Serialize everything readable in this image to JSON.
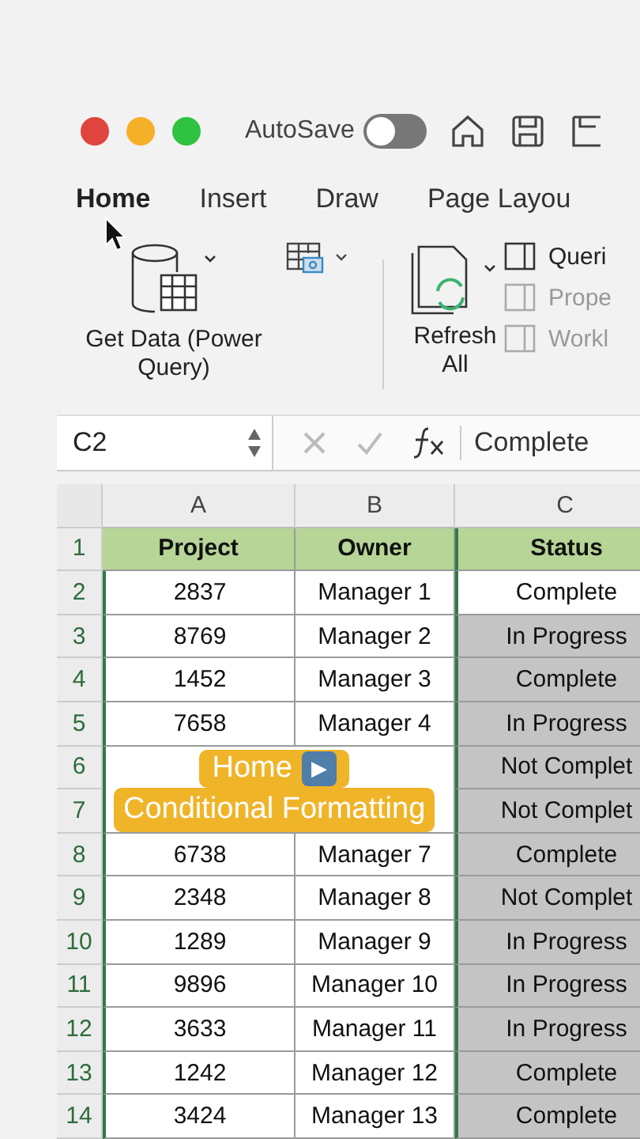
{
  "autosave": {
    "label": "AutoSave",
    "on": false
  },
  "tabs": [
    {
      "label": "Home",
      "selected": true
    },
    {
      "label": "Insert",
      "selected": false
    },
    {
      "label": "Draw",
      "selected": false
    },
    {
      "label": "Page Layou",
      "selected": false
    }
  ],
  "ribbon": {
    "get_data": "Get Data (Power Query)",
    "refresh": "Refresh All",
    "side_items": [
      {
        "label": "Queri",
        "disabled": false
      },
      {
        "label": "Prope",
        "disabled": true
      },
      {
        "label": "Workl",
        "disabled": true
      }
    ]
  },
  "name_box": "C2",
  "formula": "Complete",
  "columns": [
    "A",
    "B",
    "C"
  ],
  "rows": [
    {
      "number": "1",
      "cells": [
        {
          "text": "Project",
          "kind": "header"
        },
        {
          "text": "Owner",
          "kind": "header"
        },
        {
          "text": "Status",
          "kind": "header"
        }
      ]
    },
    {
      "number": "2",
      "cells": [
        {
          "text": "2837",
          "kind": "data"
        },
        {
          "text": "Manager 1",
          "kind": "data"
        },
        {
          "text": "Complete",
          "kind": "data",
          "highlighted": false
        }
      ]
    },
    {
      "number": "3",
      "cells": [
        {
          "text": "8769",
          "kind": "data"
        },
        {
          "text": "Manager 2",
          "kind": "data"
        },
        {
          "text": "In Progress",
          "kind": "data",
          "highlighted": true
        }
      ]
    },
    {
      "number": "4",
      "cells": [
        {
          "text": "1452",
          "kind": "data"
        },
        {
          "text": "Manager 3",
          "kind": "data"
        },
        {
          "text": "Complete",
          "kind": "data",
          "highlighted": true
        }
      ]
    },
    {
      "number": "5",
      "cells": [
        {
          "text": "7658",
          "kind": "data"
        },
        {
          "text": "Manager 4",
          "kind": "data"
        },
        {
          "text": "In Progress",
          "kind": "data",
          "highlighted": true
        }
      ]
    },
    {
      "number": "6",
      "cells": [
        {
          "kind": "covered"
        },
        {
          "kind": "covered"
        },
        {
          "text": "Not Complet",
          "kind": "data",
          "highlighted": true
        }
      ]
    },
    {
      "number": "7",
      "cells": [
        {
          "kind": "covered"
        },
        {
          "kind": "covered"
        },
        {
          "text": "Not Complet",
          "kind": "data",
          "highlighted": true
        }
      ]
    },
    {
      "number": "8",
      "cells": [
        {
          "text": "6738",
          "kind": "data"
        },
        {
          "text": "Manager 7",
          "kind": "data"
        },
        {
          "text": "Complete",
          "kind": "data",
          "highlighted": true
        }
      ]
    },
    {
      "number": "9",
      "cells": [
        {
          "text": "2348",
          "kind": "data"
        },
        {
          "text": "Manager 8",
          "kind": "data"
        },
        {
          "text": "Not Complet",
          "kind": "data",
          "highlighted": true
        }
      ]
    },
    {
      "number": "10",
      "cells": [
        {
          "text": "1289",
          "kind": "data"
        },
        {
          "text": "Manager 9",
          "kind": "data"
        },
        {
          "text": "In Progress",
          "kind": "data",
          "highlighted": true
        }
      ]
    },
    {
      "number": "11",
      "cells": [
        {
          "text": "9896",
          "kind": "data"
        },
        {
          "text": "Manager 10",
          "kind": "data"
        },
        {
          "text": "In Progress",
          "kind": "data",
          "highlighted": true
        }
      ]
    },
    {
      "number": "12",
      "cells": [
        {
          "text": "3633",
          "kind": "data"
        },
        {
          "text": "Manager 11",
          "kind": "data"
        },
        {
          "text": "In Progress",
          "kind": "data",
          "highlighted": true
        }
      ]
    },
    {
      "number": "13",
      "cells": [
        {
          "text": "1242",
          "kind": "data"
        },
        {
          "text": "Manager 12",
          "kind": "data"
        },
        {
          "text": "Complete",
          "kind": "data",
          "highlighted": true
        }
      ]
    },
    {
      "number": "14",
      "cells": [
        {
          "text": "3424",
          "kind": "data"
        },
        {
          "text": "Manager 13",
          "kind": "data"
        },
        {
          "text": "Complete",
          "kind": "data",
          "highlighted": true
        }
      ]
    }
  ],
  "caption": {
    "line1": "Home",
    "glyph": "▶",
    "line2": "Conditional Formatting"
  }
}
